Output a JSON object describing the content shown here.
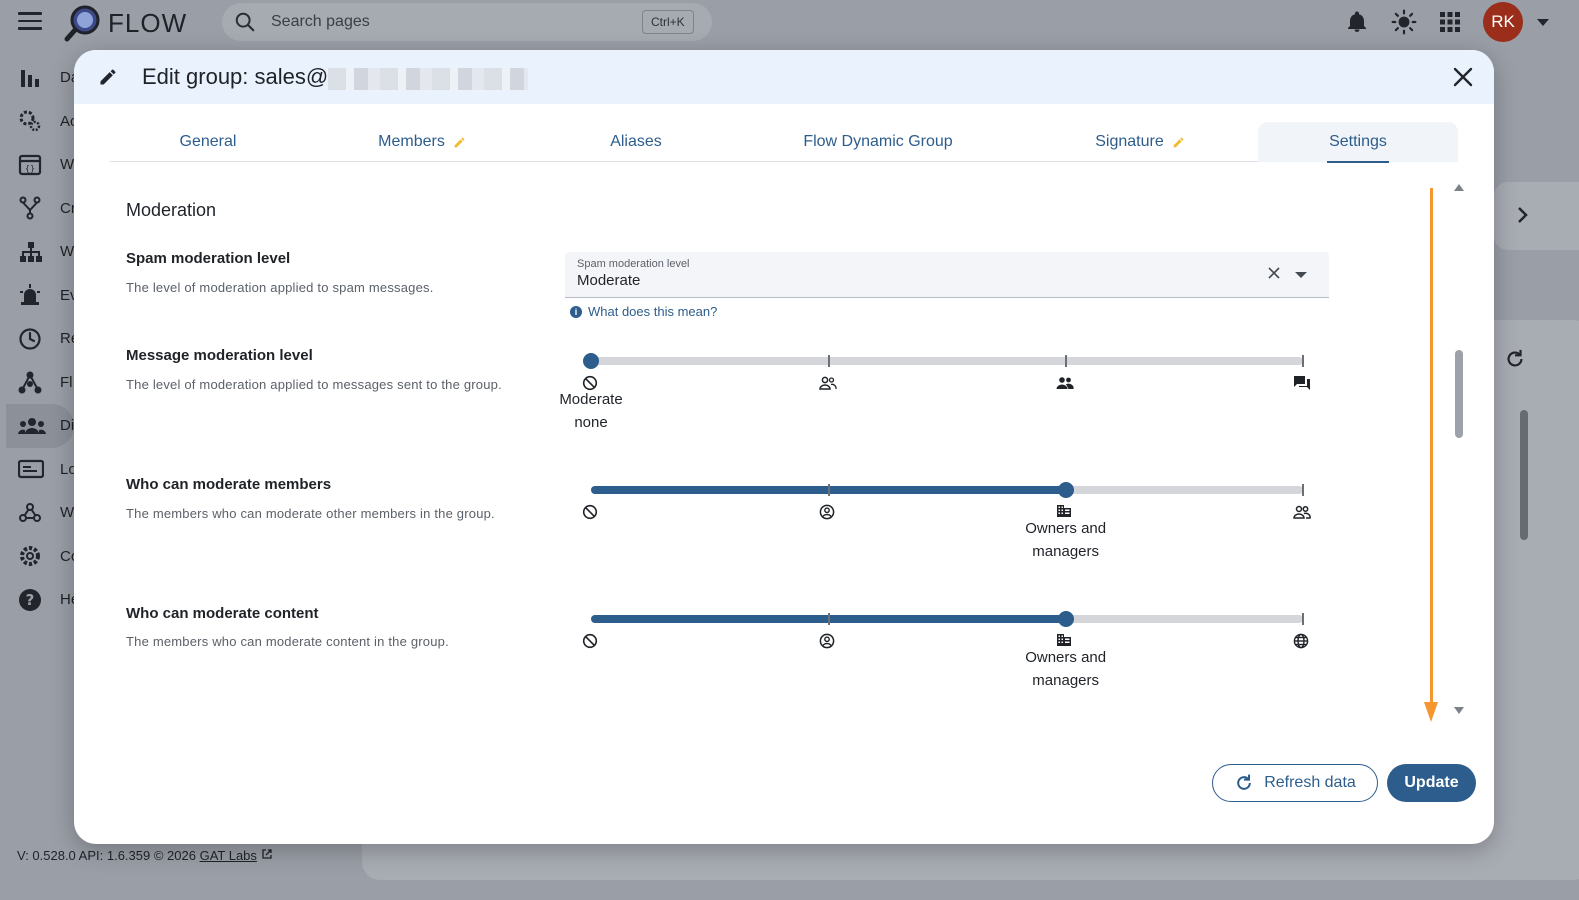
{
  "app": {
    "logo_text": "FLOW",
    "avatar_initials": "RK"
  },
  "search": {
    "placeholder": "Search pages",
    "shortcut": "Ctrl+K"
  },
  "sidebar": {
    "items": [
      {
        "label": "Da",
        "icon": "bar-chart-icon"
      },
      {
        "label": "Ac",
        "icon": "gears-icon"
      },
      {
        "label": "W",
        "icon": "web-window-icon"
      },
      {
        "label": "Cr",
        "icon": "branch-icon"
      },
      {
        "label": "W",
        "icon": "hierarchy-icon"
      },
      {
        "label": "Ev",
        "icon": "alarm-icon"
      },
      {
        "label": "Re",
        "icon": "clock-icon"
      },
      {
        "label": "Fl",
        "icon": "flow-icon"
      },
      {
        "label": "Di",
        "icon": "groups-icon"
      },
      {
        "label": "Lo",
        "icon": "log-icon"
      },
      {
        "label": "W",
        "icon": "webhook-icon"
      },
      {
        "label": "Co",
        "icon": "settings-icon"
      },
      {
        "label": "He",
        "icon": "help-icon"
      }
    ]
  },
  "footer": {
    "version": "V: 0.528.0   API: 1.6.359   © 2026 ",
    "link": "GAT Labs"
  },
  "modal": {
    "title": "Edit group: sales@",
    "tabs": [
      {
        "label": "General",
        "edited": false
      },
      {
        "label": "Members",
        "edited": true
      },
      {
        "label": "Aliases",
        "edited": false
      },
      {
        "label": "Flow Dynamic Group",
        "edited": false
      },
      {
        "label": "Signature",
        "edited": true
      },
      {
        "label": "Settings",
        "edited": false,
        "active": true
      }
    ],
    "section_title": "Moderation",
    "spam": {
      "title": "Spam moderation level",
      "desc": "The level of moderation applied to spam messages.",
      "field_label": "Spam moderation level",
      "value": "Moderate",
      "help": "What does this mean?"
    },
    "message_moderation": {
      "title": "Message moderation level",
      "desc": "The level of moderation applied to messages sent to the group.",
      "selected_index": 0,
      "selected_label_line1": "Moderate",
      "selected_label_line2": "none",
      "marks": [
        "block-icon",
        "person-outline-icon",
        "people-icon",
        "forum-icon"
      ]
    },
    "moderate_members": {
      "title": "Who can moderate members",
      "desc": "The members who can moderate other members in the group.",
      "selected_index": 2,
      "selected_label_line1": "Owners and",
      "selected_label_line2": "managers",
      "marks": [
        "block-icon",
        "account-circle-icon",
        "domain-icon",
        "people-outline-icon"
      ]
    },
    "moderate_content": {
      "title": "Who can moderate content",
      "desc": "The members who can moderate content in the group.",
      "selected_index": 2,
      "selected_label_line1": "Owners and",
      "selected_label_line2": "managers",
      "marks": [
        "block-icon",
        "account-circle-icon",
        "domain-icon",
        "globe-icon"
      ]
    },
    "buttons": {
      "refresh": "Refresh data",
      "update": "Update"
    }
  },
  "colors": {
    "primary": "#2d5d8c",
    "annotation_arrow": "#f59630",
    "avatar": "#9a2e1a",
    "header_bg": "#eaf2fd"
  }
}
